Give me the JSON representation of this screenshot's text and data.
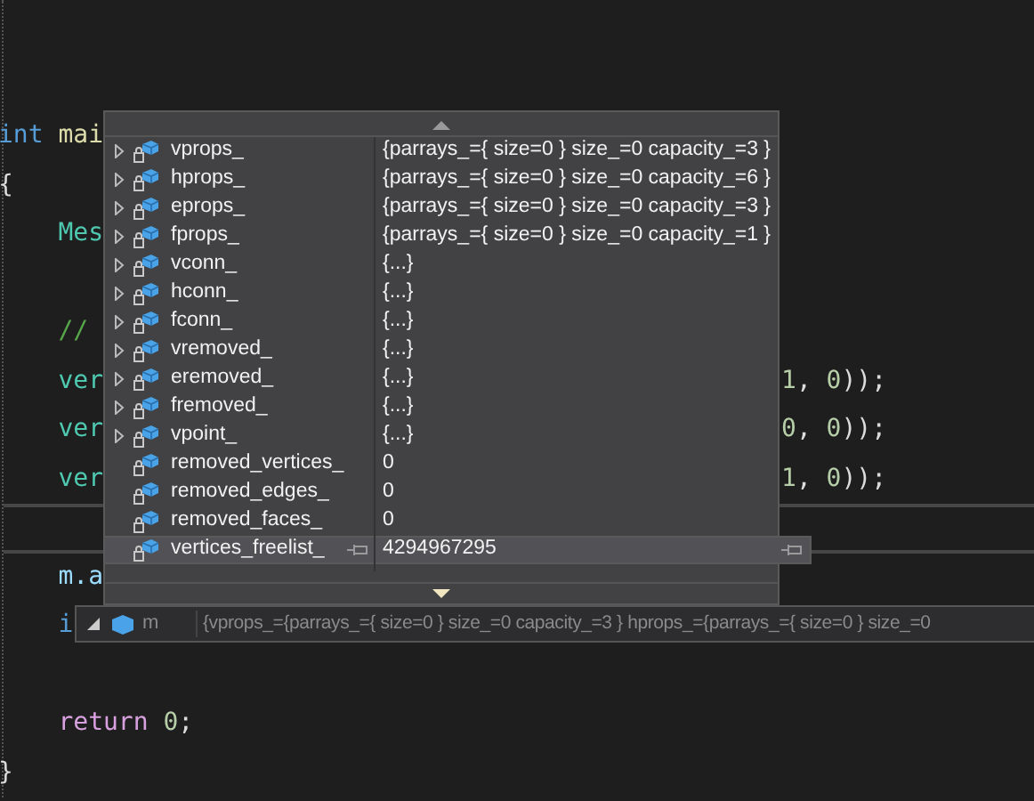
{
  "code_lines": [
    {
      "kind": "code",
      "left": [
        {
          "text": "int",
          "kind": "keyword"
        },
        {
          "text": " mai",
          "kind": "function"
        }
      ]
    },
    {
      "kind": "code",
      "left": [
        {
          "text": "{",
          "kind": "plain"
        }
      ]
    },
    {
      "kind": "code",
      "left": [
        {
          "text": "    Mes",
          "kind": "type"
        }
      ]
    },
    {
      "kind": "blank"
    },
    {
      "kind": "code",
      "left": [
        {
          "text": "    //",
          "kind": "comment"
        }
      ]
    },
    {
      "kind": "code",
      "left": [
        {
          "text": "    ver",
          "kind": "type"
        }
      ],
      "right": [
        {
          "text": "1",
          "kind": "number"
        },
        {
          "text": ", ",
          "kind": "plain"
        },
        {
          "text": "0",
          "kind": "number"
        },
        {
          "text": "));",
          "kind": "plain"
        }
      ]
    },
    {
      "kind": "code",
      "left": [
        {
          "text": "    ver",
          "kind": "type"
        }
      ],
      "right": [
        {
          "text": "0",
          "kind": "number"
        },
        {
          "text": ", ",
          "kind": "plain"
        },
        {
          "text": "0",
          "kind": "number"
        },
        {
          "text": "));",
          "kind": "plain"
        }
      ]
    },
    {
      "kind": "code",
      "left": [
        {
          "text": "    ver",
          "kind": "type"
        }
      ],
      "right": [
        {
          "text": "1",
          "kind": "number"
        },
        {
          "text": ", ",
          "kind": "plain"
        },
        {
          "text": "0",
          "kind": "number"
        },
        {
          "text": "));",
          "kind": "plain"
        }
      ]
    },
    {
      "kind": "current"
    },
    {
      "kind": "code",
      "left": [
        {
          "text": "    m.a",
          "kind": "variable"
        }
      ]
    },
    {
      "kind": "code",
      "left": [
        {
          "text": "    i",
          "kind": "keyword"
        }
      ]
    },
    {
      "kind": "blank"
    },
    {
      "kind": "code",
      "left": [
        {
          "text": "    return",
          "kind": "control"
        },
        {
          "text": " 0",
          "kind": "number"
        },
        {
          "text": ";",
          "kind": "plain"
        }
      ]
    },
    {
      "kind": "code",
      "left": [
        {
          "text": "}",
          "kind": "plain"
        }
      ]
    }
  ],
  "datatip": {
    "members": [
      {
        "name": "vprops_",
        "value": "{parrays_={ size=0 } size_=0 capacity_=3 }",
        "expandable": true,
        "selected": false
      },
      {
        "name": "hprops_",
        "value": "{parrays_={ size=0 } size_=0 capacity_=6 }",
        "expandable": true,
        "selected": false
      },
      {
        "name": "eprops_",
        "value": "{parrays_={ size=0 } size_=0 capacity_=3 }",
        "expandable": true,
        "selected": false
      },
      {
        "name": "fprops_",
        "value": "{parrays_={ size=0 } size_=0 capacity_=1 }",
        "expandable": true,
        "selected": false
      },
      {
        "name": "vconn_",
        "value": "{...}",
        "expandable": true,
        "selected": false
      },
      {
        "name": "hconn_",
        "value": "{...}",
        "expandable": true,
        "selected": false
      },
      {
        "name": "fconn_",
        "value": "{...}",
        "expandable": true,
        "selected": false
      },
      {
        "name": "vremoved_",
        "value": "{...}",
        "expandable": true,
        "selected": false
      },
      {
        "name": "eremoved_",
        "value": "{...}",
        "expandable": true,
        "selected": false
      },
      {
        "name": "fremoved_",
        "value": "{...}",
        "expandable": true,
        "selected": false
      },
      {
        "name": "vpoint_",
        "value": "{...}",
        "expandable": true,
        "selected": false
      },
      {
        "name": "removed_vertices_",
        "value": "0",
        "expandable": false,
        "selected": false
      },
      {
        "name": "removed_edges_",
        "value": "0",
        "expandable": false,
        "selected": false
      },
      {
        "name": "removed_faces_",
        "value": "0",
        "expandable": false,
        "selected": false
      },
      {
        "name": "vertices_freelist_",
        "value": "4294967295",
        "expandable": false,
        "selected": true
      }
    ]
  },
  "root_tip": {
    "name": "m",
    "value": "{vprops_={parrays_={ size=0 } size_=0 capacity_=3 } hprops_={parrays_={ size=0 } size_=0",
    "expanded": true
  }
}
